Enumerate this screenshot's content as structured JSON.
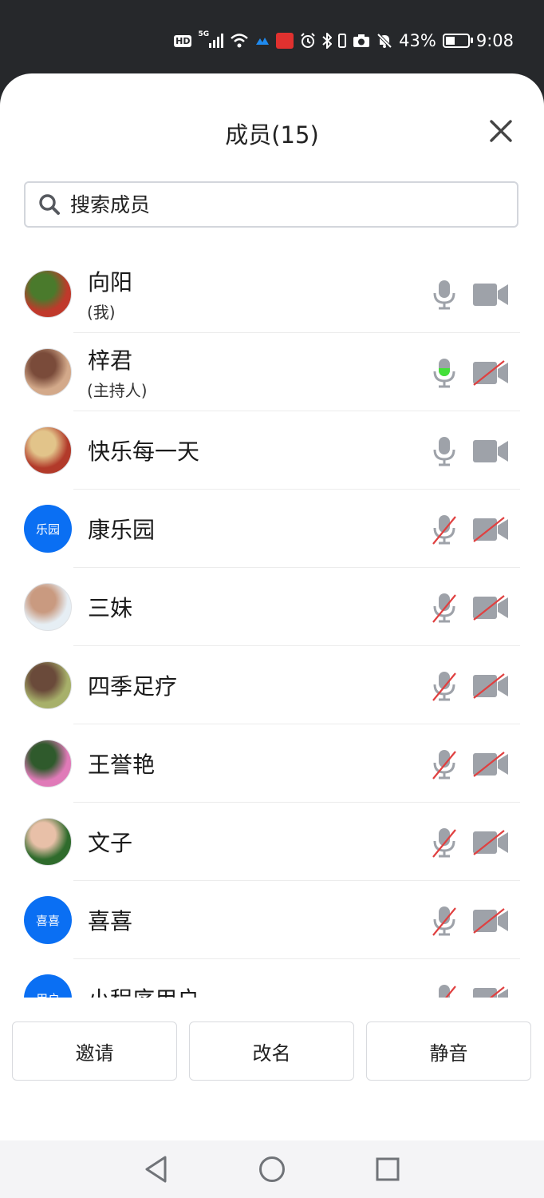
{
  "status_bar": {
    "network": "5G",
    "hd": "HD",
    "battery": "43%",
    "battery_level": 0.43,
    "time": "9:08"
  },
  "header": {
    "title": "成员(15)"
  },
  "search": {
    "placeholder": "搜索成员"
  },
  "members": [
    {
      "name": "向阳",
      "role": "(我)",
      "mic": "on",
      "camera": "on",
      "avatar_colors": [
        "#c0392b",
        "#4a7a2c"
      ]
    },
    {
      "name": "梓君",
      "role": "(主持人)",
      "mic": "speaking",
      "camera": "off",
      "avatar_colors": [
        "#d3a98a",
        "#7a4b3a"
      ]
    },
    {
      "name": "快乐每一天",
      "role": "",
      "mic": "on",
      "camera": "on",
      "avatar_colors": [
        "#b23a2a",
        "#e2c48a"
      ]
    },
    {
      "name": "康乐园",
      "role": "",
      "mic": "off",
      "camera": "off",
      "avatar_initials": "乐园"
    },
    {
      "name": "三妹",
      "role": "",
      "mic": "off",
      "camera": "off",
      "avatar_colors": [
        "#e6eef4",
        "#c99a80"
      ]
    },
    {
      "name": "四季足疗",
      "role": "",
      "mic": "off",
      "camera": "off",
      "avatar_colors": [
        "#a7b06a",
        "#6a4a3a"
      ]
    },
    {
      "name": "王誉艳",
      "role": "",
      "mic": "off",
      "camera": "off",
      "avatar_colors": [
        "#e07ab8",
        "#2f5a2c"
      ]
    },
    {
      "name": "文子",
      "role": "",
      "mic": "off",
      "camera": "off",
      "avatar_colors": [
        "#2f6b2c",
        "#e8c0a8"
      ]
    },
    {
      "name": "喜喜",
      "role": "",
      "mic": "off",
      "camera": "off",
      "avatar_initials": "喜喜"
    },
    {
      "name": "小程序用户",
      "role": "",
      "mic": "off",
      "camera": "off",
      "avatar_initials": "用户"
    }
  ],
  "footer": {
    "invite": "邀请",
    "rename": "改名",
    "mute": "静音"
  },
  "colors": {
    "accent_blue": "#0a6ff3",
    "speaking_green": "#44e03a",
    "muted_red": "#e04040",
    "icon_gray": "#9ea2a9"
  }
}
